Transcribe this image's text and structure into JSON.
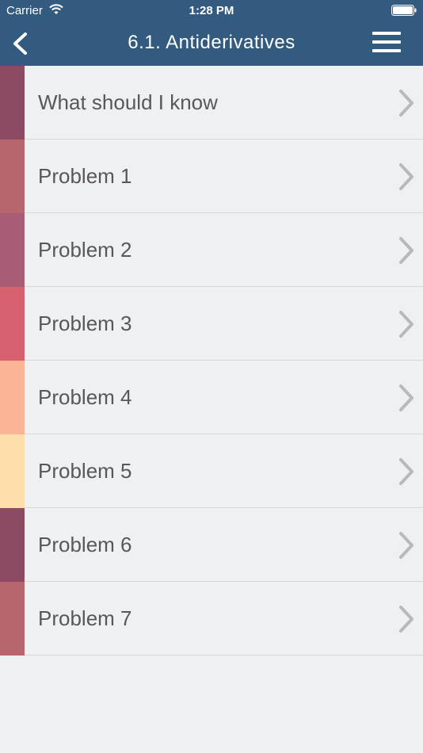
{
  "status_bar": {
    "carrier": "Carrier",
    "time": "1:28 PM"
  },
  "nav": {
    "title": "6.1. Antiderivatives",
    "back_icon": "chevron-left-icon",
    "menu_icon": "hamburger-menu-icon"
  },
  "colors": {
    "nav_background": "#335b80",
    "list_background": "#eff0f2",
    "label_text": "#58585a",
    "chevron": "#b8b9bb"
  },
  "items": [
    {
      "label": "What should I know",
      "color": "#8c4a63"
    },
    {
      "label": "Problem 1",
      "color": "#b8666d"
    },
    {
      "label": "Problem 2",
      "color": "#a85c76"
    },
    {
      "label": "Problem 3",
      "color": "#d5626e"
    },
    {
      "label": "Problem 4",
      "color": "#fbb495"
    },
    {
      "label": "Problem 5",
      "color": "#fedeaa"
    },
    {
      "label": "Problem 6",
      "color": "#8c4a63"
    },
    {
      "label": "Problem 7",
      "color": "#b8666d"
    }
  ]
}
